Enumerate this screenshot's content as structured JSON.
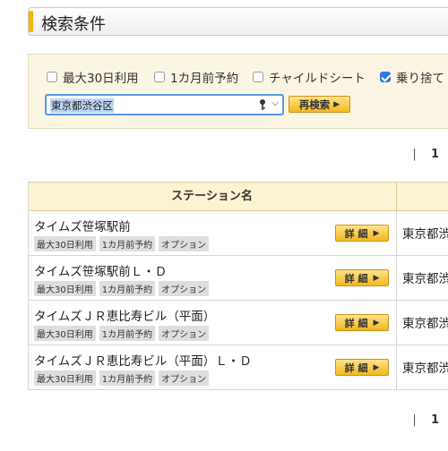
{
  "header": {
    "title": "検索条件"
  },
  "filters": {
    "options": [
      {
        "label": "最大30日利用",
        "checked": false
      },
      {
        "label": "1カ月前予約",
        "checked": false
      },
      {
        "label": "チャイルドシート",
        "checked": false
      },
      {
        "label": "乗り捨て",
        "checked": true
      }
    ],
    "location_value": "東京都渋谷区",
    "research_button": "再検索"
  },
  "pager_top": {
    "separator": "|",
    "page": "1"
  },
  "pager_bottom": {
    "separator": "|",
    "page": "1"
  },
  "table": {
    "column_header": "ステーション名",
    "detail_label": "詳 細",
    "rows": [
      {
        "name": "タイムズ笹塚駅前",
        "tags": [
          "最大30日利用",
          "1カ月前予約",
          "オプション"
        ],
        "address": "東京都渋"
      },
      {
        "name": "タイムズ笹塚駅前Ｌ・Ｄ",
        "tags": [
          "最大30日利用",
          "1カ月前予約",
          "オプション"
        ],
        "address": "東京都渋"
      },
      {
        "name": "タイムズＪＲ恵比寿ビル（平面）",
        "tags": [
          "最大30日利用",
          "1カ月前予約",
          "オプション"
        ],
        "address": "東京都渋"
      },
      {
        "name": "タイムズＪＲ恵比寿ビル（平面）Ｌ・Ｄ",
        "tags": [
          "最大30日利用",
          "1カ月前予約",
          "オプション"
        ],
        "address": "東京都渋"
      }
    ]
  }
}
